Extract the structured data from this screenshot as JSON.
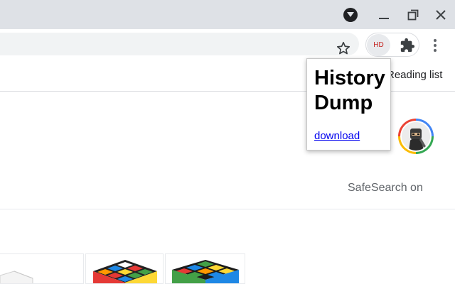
{
  "browser": {
    "extension_badge": "HD",
    "bookmarks_bar": {
      "reading_list_label": "Reading list"
    }
  },
  "page": {
    "safesearch_label": "SafeSearch on"
  },
  "popup": {
    "title": "History Dump",
    "link_label": "download"
  },
  "colors": {
    "titlebar": "#dee1e6",
    "omnibox": "#f1f3f4",
    "link": "#0000ee",
    "badge_text": "#c5221f"
  },
  "icons": {
    "tab_search": "chevron-down-circle-icon",
    "minimize": "minimize-icon",
    "restore": "restore-icon",
    "close": "close-icon",
    "bookmark": "star-outline-icon",
    "extensions": "puzzle-icon",
    "menu": "kebab-menu-icon",
    "avatar": "profile-avatar"
  }
}
